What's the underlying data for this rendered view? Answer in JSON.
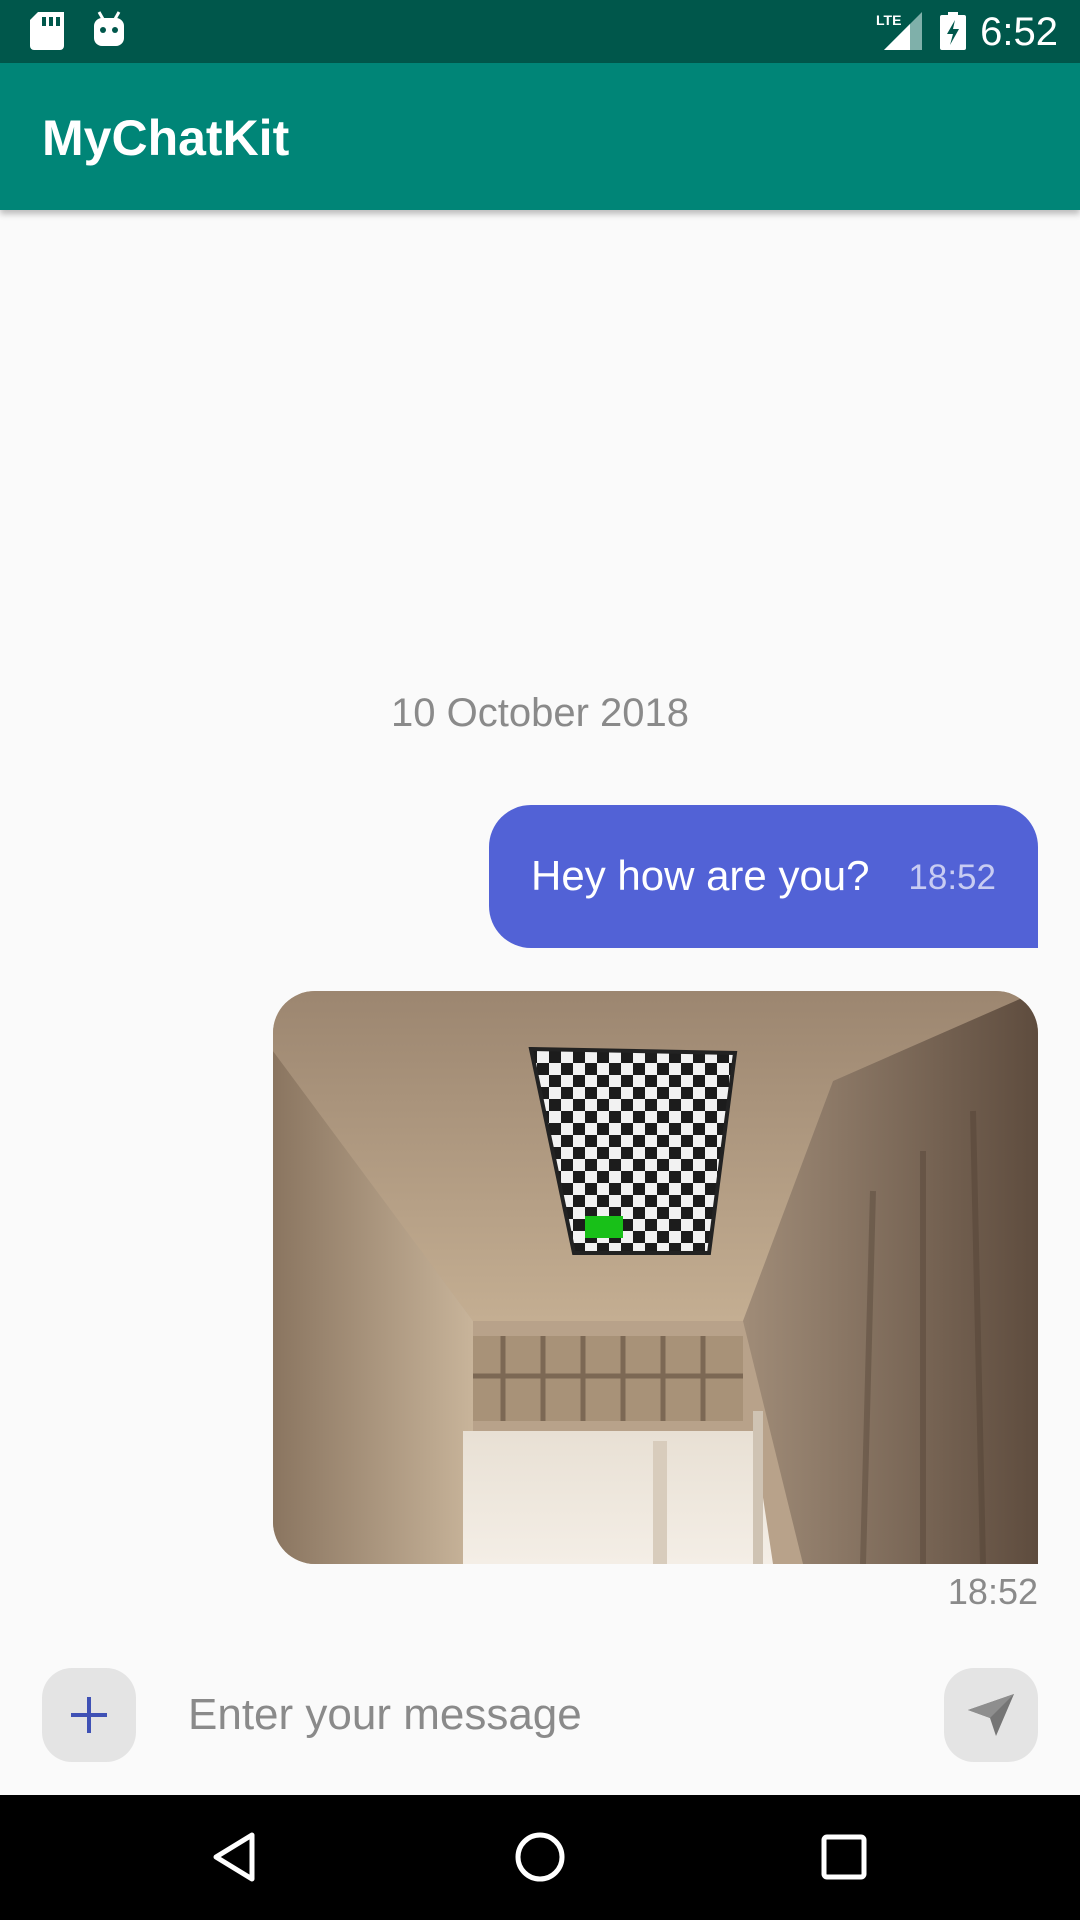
{
  "status_bar": {
    "time": "6:52",
    "network": "LTE"
  },
  "app_bar": {
    "title": "MyChatKit"
  },
  "messages": {
    "date_header": "10 October 2018",
    "text_message": {
      "text": "Hey how are you?",
      "time": "18:52"
    },
    "image_message": {
      "time": "18:52"
    }
  },
  "input": {
    "placeholder": "Enter your message",
    "value": ""
  },
  "colors": {
    "status_bar": "#00574b",
    "app_bar": "#008577",
    "bubble": "#5262d6",
    "accent_plus": "#3f51b5"
  },
  "icons": {
    "add": "plus-icon",
    "send": "send-icon",
    "back": "back-triangle-icon",
    "home": "home-circle-icon",
    "recents": "recents-square-icon"
  }
}
